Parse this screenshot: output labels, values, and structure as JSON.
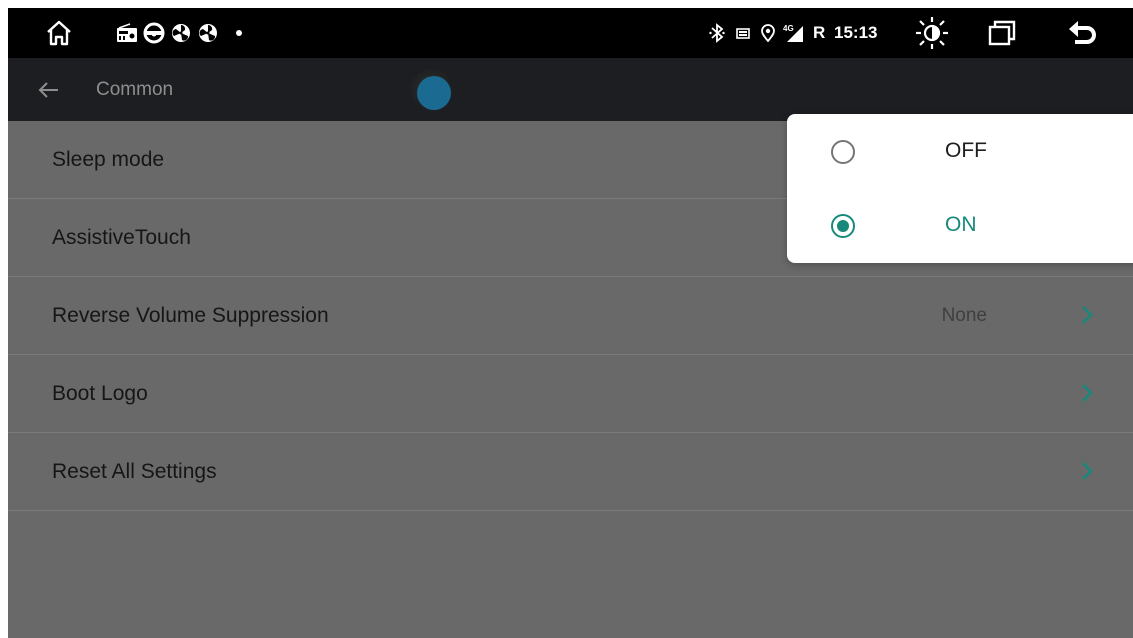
{
  "status_bar": {
    "time": "15:13",
    "network": "4G",
    "carrier_flag": "R",
    "icons_left": [
      "home-icon",
      "radio-icon",
      "steering-wheel-icon",
      "fan-icon",
      "fan-icon-2",
      "dot-icon"
    ],
    "icons_right": [
      "bluetooth-icon",
      "sim-icon",
      "location-icon",
      "signal-icon",
      "brightness-icon",
      "recent-apps-icon",
      "back-icon"
    ]
  },
  "header": {
    "title": "Common"
  },
  "settings": {
    "items": [
      {
        "label": "Sleep mode",
        "value": "",
        "chevron": false
      },
      {
        "label": "AssistiveTouch",
        "value": "",
        "chevron": false
      },
      {
        "label": "Reverse Volume Suppression",
        "value": "None",
        "chevron": true
      },
      {
        "label": "Boot Logo",
        "value": "",
        "chevron": true
      },
      {
        "label": "Reset All Settings",
        "value": "",
        "chevron": true
      }
    ]
  },
  "popup": {
    "options": [
      {
        "label": "OFF",
        "selected": false
      },
      {
        "label": "ON",
        "selected": true
      }
    ]
  },
  "colors": {
    "accent": "#17897a",
    "chevron": "#17897a",
    "background": "#696969",
    "titlebar": "#1c1e21"
  }
}
